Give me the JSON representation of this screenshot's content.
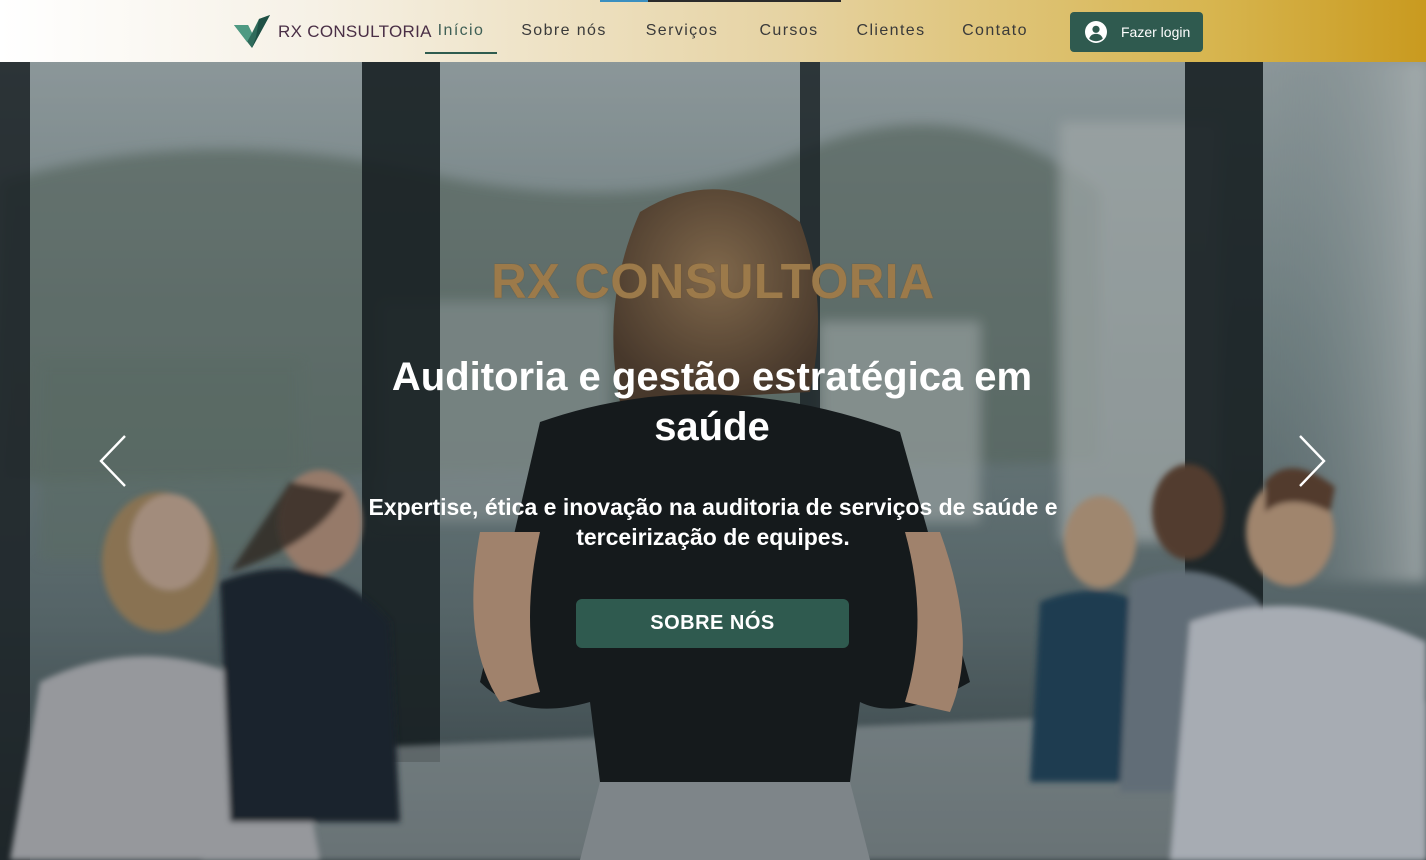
{
  "header": {
    "brand": "RX CONSULTORIA",
    "nav": [
      {
        "label": "Início",
        "active": true
      },
      {
        "label": "Sobre nós",
        "active": false
      },
      {
        "label": "Serviços",
        "active": false
      },
      {
        "label": "Cursos",
        "active": false
      },
      {
        "label": "Clientes",
        "active": false
      },
      {
        "label": "Contato",
        "active": false
      }
    ],
    "login_label": "Fazer login",
    "login_icon": "user-avatar-icon",
    "logo_icon": "checkmark-logo-icon"
  },
  "hero": {
    "brand": "RX CONSULTORIA",
    "title": "Auditoria e gestão estratégica em saúde",
    "subtitle": "Expertise, ética e inovação na auditoria de serviços de saúde e terceirização de equipes.",
    "cta_label": "SOBRE NÓS",
    "prev_icon": "chevron-left-icon",
    "next_icon": "chevron-right-icon"
  },
  "colors": {
    "accent_green": "#2f5a4f",
    "brand_gold": "#9c7a4a",
    "header_gradient_end": "#c99a1f",
    "logo_text": "#4a2f46"
  }
}
